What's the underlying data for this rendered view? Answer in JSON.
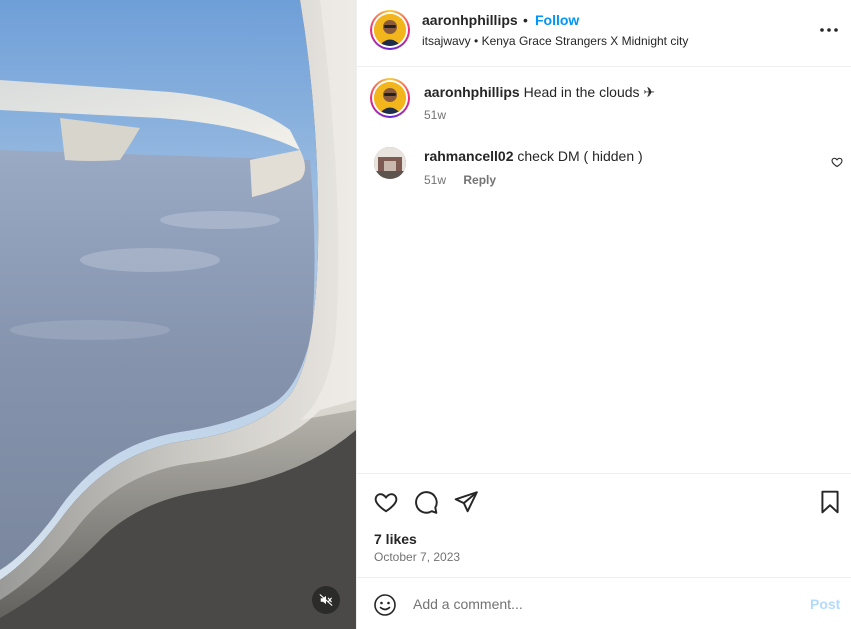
{
  "post": {
    "username": "aaronhphillips",
    "follow_label": "Follow",
    "separator": "•",
    "audio_artist": "itsajwavy",
    "audio_track": "Kenya Grace Strangers X Midnight city",
    "likes": "7 likes",
    "date": "October 7, 2023"
  },
  "comments": [
    {
      "username": "aaronhphillips",
      "text": "Head in the clouds ✈",
      "age": "51w"
    },
    {
      "username": "rahmancell02",
      "text": "check DM ( hidden )",
      "age": "51w",
      "reply_label": "Reply"
    }
  ],
  "composer": {
    "placeholder": "Add a comment...",
    "post_label": "Post"
  },
  "icons": {
    "more": "more-horizontal-icon",
    "mute": "volume-muted-icon",
    "like": "heart-icon",
    "comment": "comment-bubble-icon",
    "share": "paper-plane-icon",
    "save": "bookmark-icon",
    "emoji": "emoji-smile-icon"
  },
  "colors": {
    "follow_blue": "#0095f6",
    "post_disabled": "#b3dbff",
    "secondary_text": "#737373"
  }
}
